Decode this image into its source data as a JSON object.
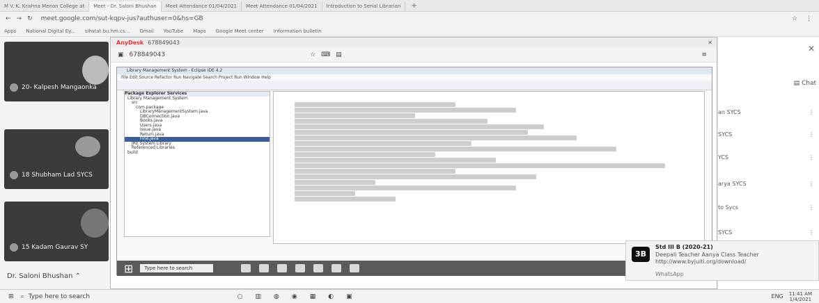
{
  "browser": {
    "tabs": [
      {
        "label": "M  V. K. Krishna Menon College at"
      },
      {
        "label": "Meet - Dr. Saloni Bhushan"
      },
      {
        "label": "Meet Attendance 01/04/2021"
      },
      {
        "label": "Meet Attendance 01/04/2021"
      },
      {
        "label": "Introduction to Serial Librarian"
      }
    ],
    "url": "meet.google.com/sut-kqpv-jus?authuser=0&hs=GB",
    "bookmarks": [
      "Apps",
      "National Digital Ey...",
      "sihstat.bu.hm.cs...",
      "Gmail",
      "YouTube",
      "Maps",
      "Google Meet center",
      "Information bulletin"
    ]
  },
  "meet": {
    "participants": [
      {
        "name": "20- Kalpesh Mangaonka"
      },
      {
        "name": "18 Shubham Lad SYCS"
      },
      {
        "name": "15 Kadam Gaurav SY"
      }
    ],
    "presenter": "Dr. Saloni Bhushan",
    "chat_label": "Chat",
    "side_list": [
      "an SYCS",
      "SYCS",
      "YCS",
      "arya SYCS",
      "to Sycs",
      "SYCS",
      "SYCS"
    ]
  },
  "anydesk": {
    "title": "AnyDesk",
    "address_tab": "678849043",
    "remote_id": "678849043",
    "eclipse": {
      "title": "Library Management System - Eclipse IDE 4.2",
      "menu": "File  Edit  Source  Refactor  Run  Navigate  Search  Project  Run  Window  Help",
      "tabs": "Package Explorer   Services",
      "project_tree": [
        "Library Management System",
        "src",
        "com.package",
        "LibraryManagementSystem.java",
        "DBConnection.java",
        "Books.java",
        "Users.java",
        "Issue.java",
        "Return.java",
        "Fine.java",
        "JRE System Library",
        "Referenced Libraries",
        "build"
      ],
      "search_placeholder": "Type here to search"
    }
  },
  "notification": {
    "title": "Std III B (2020-21)",
    "line1": "Deepali Teacher Aanya Class Teacher",
    "line2": "http://www.byjuiti.org/download/",
    "line3": "WhatsApp"
  },
  "taskbar": {
    "search_placeholder": "Type here to search",
    "time": "11:41 AM",
    "date": "1/4/2021",
    "lang": "ENG"
  }
}
